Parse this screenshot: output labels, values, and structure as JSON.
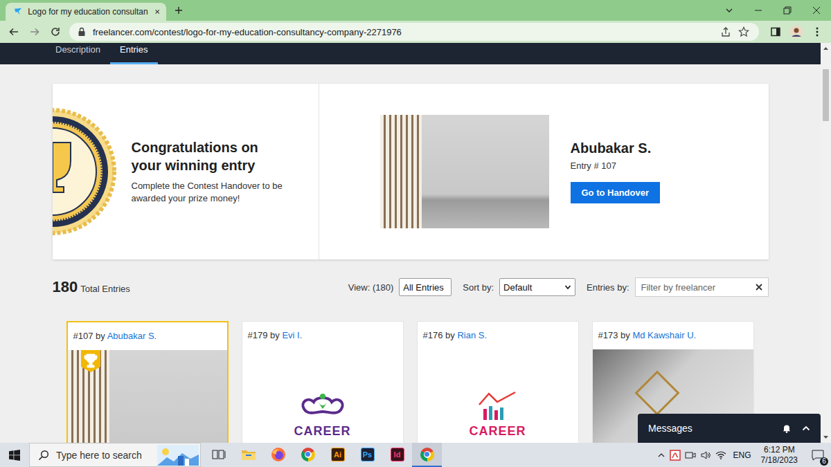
{
  "browser": {
    "tab_title": "Logo for my education consultan",
    "url": "freelancer.com/contest/logo-for-my-education-consultancy-company-2271976"
  },
  "page_tabs": [
    {
      "label": "Description",
      "selected": false
    },
    {
      "label": "Entries",
      "selected": true
    }
  ],
  "winner": {
    "heading": "Congratulations on your winning entry",
    "message": "Complete the Contest Handover to be awarded your prize money!",
    "name": "Abubakar S.",
    "entry": "Entry # 107",
    "button": "Go to Handover"
  },
  "toolbar": {
    "total": "180",
    "total_label": "Total Entries",
    "view_label": "View: (180)",
    "view_value": "All Entries",
    "sort_label": "Sort by:",
    "sort_value": "Default",
    "entries_by_label": "Entries by:",
    "filter_placeholder": "Filter by freelancer"
  },
  "entries": [
    {
      "header": "#107 by",
      "author": "Abubakar S.",
      "winner": true,
      "kind": "wall-mockup"
    },
    {
      "header": "#179 by",
      "author": "Evi I.",
      "winner": false,
      "kind": "logo",
      "logo_text": "CAREER",
      "color": "#5b2b8c"
    },
    {
      "header": "#176 by",
      "author": "Rian S.",
      "winner": false,
      "kind": "chart-logo",
      "logo_text": "CAREER",
      "color": "#d81b60"
    },
    {
      "header": "#173 by",
      "author": "Md Kawshair U.",
      "winner": false,
      "kind": "paper-mockup"
    }
  ],
  "messages": {
    "label": "Messages"
  },
  "taskbar": {
    "search_placeholder": "Type here to search",
    "apps": [
      {
        "kind": "task-view",
        "active": false
      },
      {
        "kind": "explorer",
        "active": false
      },
      {
        "kind": "firefox",
        "active": false
      },
      {
        "kind": "chrome",
        "active": false
      },
      {
        "kind": "adobe",
        "label": "Ai",
        "color": "#ff9a00",
        "active": false
      },
      {
        "kind": "adobe",
        "label": "Ps",
        "color": "#31a8ff",
        "active": false
      },
      {
        "kind": "adobe",
        "label": "Id",
        "color": "#ff3366",
        "active": false
      },
      {
        "kind": "chrome",
        "active": true
      }
    ],
    "tray": {
      "language": "ENG",
      "time": "6:12 PM",
      "date": "7/18/2023",
      "notifications": "6"
    }
  }
}
